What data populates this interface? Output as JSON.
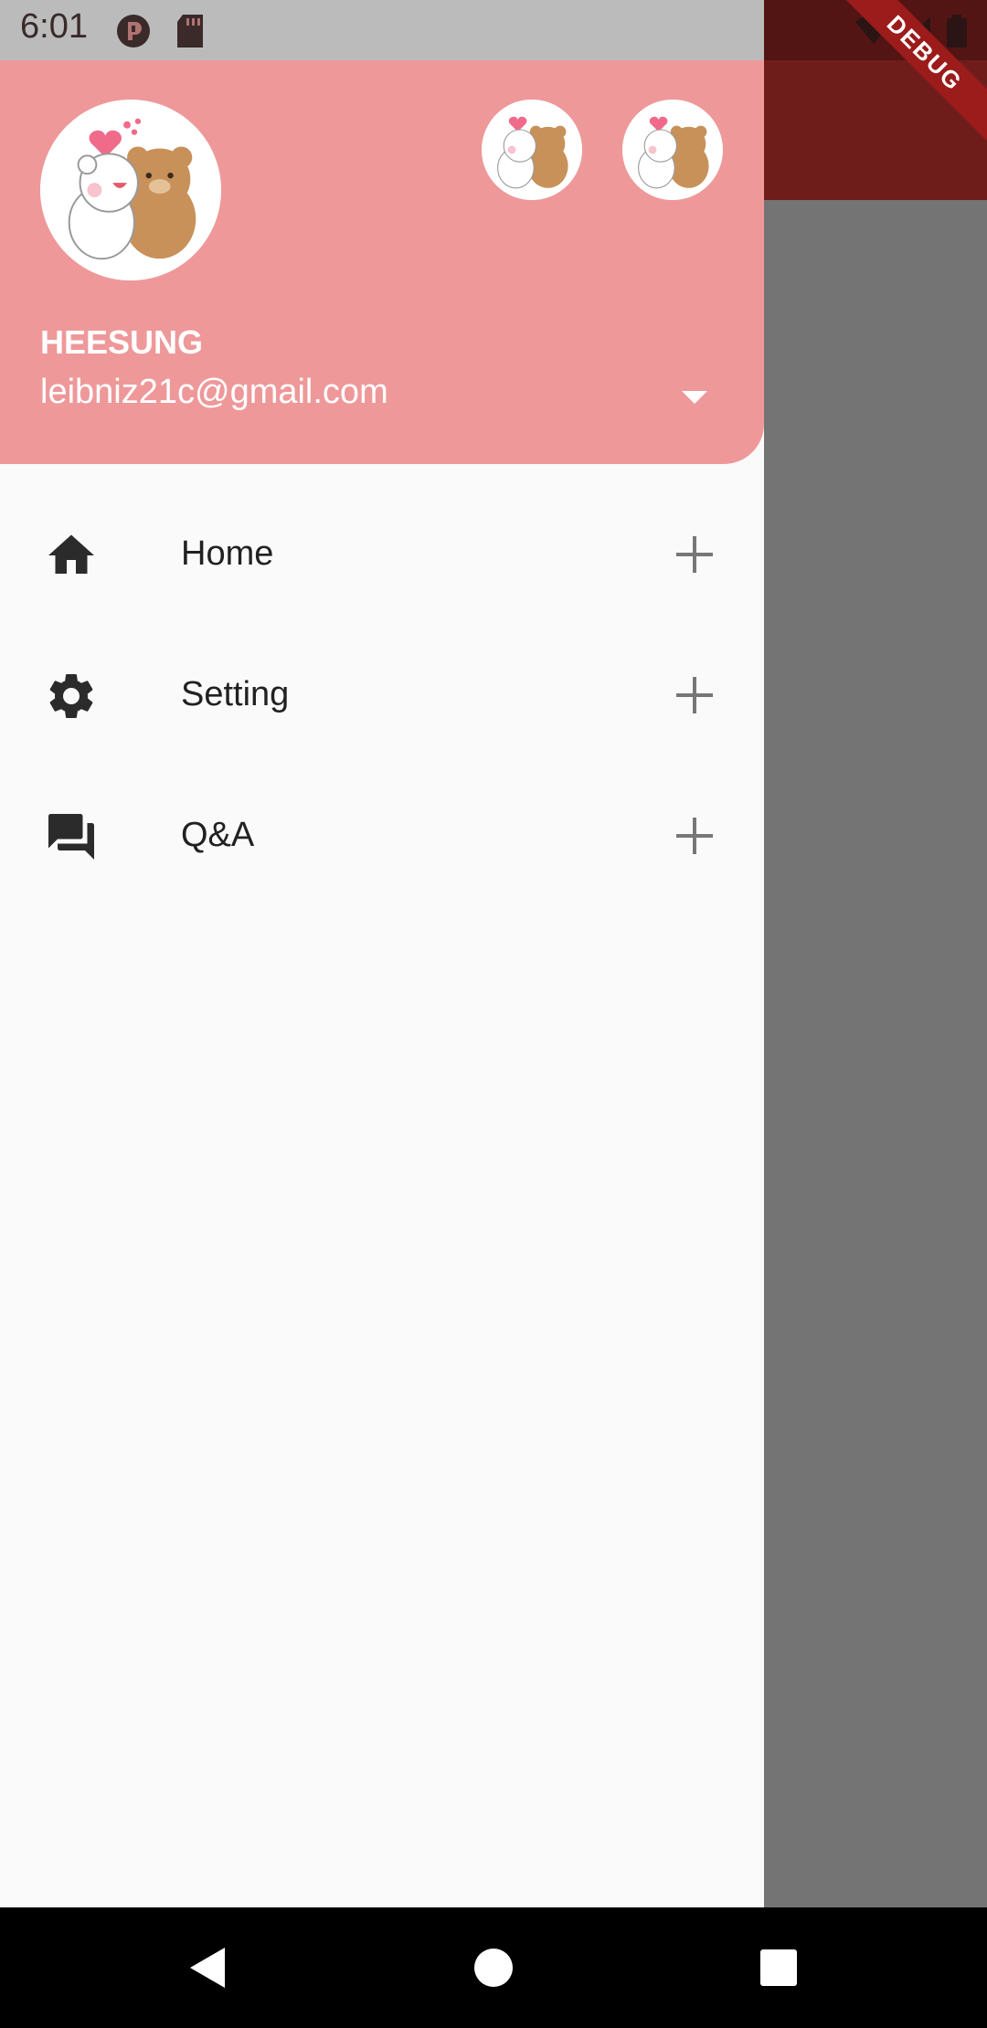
{
  "status_bar": {
    "time": "6:01"
  },
  "debug_banner": {
    "label": "DEBUG"
  },
  "drawer": {
    "account": {
      "name": "HEESUNG",
      "email": "leibniz21c@gmail.com"
    },
    "menu": [
      {
        "label": "Home",
        "icon": "home-icon"
      },
      {
        "label": "Setting",
        "icon": "gear-icon"
      },
      {
        "label": "Q&A",
        "icon": "forum-icon"
      }
    ]
  },
  "colors": {
    "header_bg": "#ee989a",
    "app_bar": "#6f1d1b",
    "scrim": "#747474",
    "drawer_bg": "#fafafa"
  }
}
